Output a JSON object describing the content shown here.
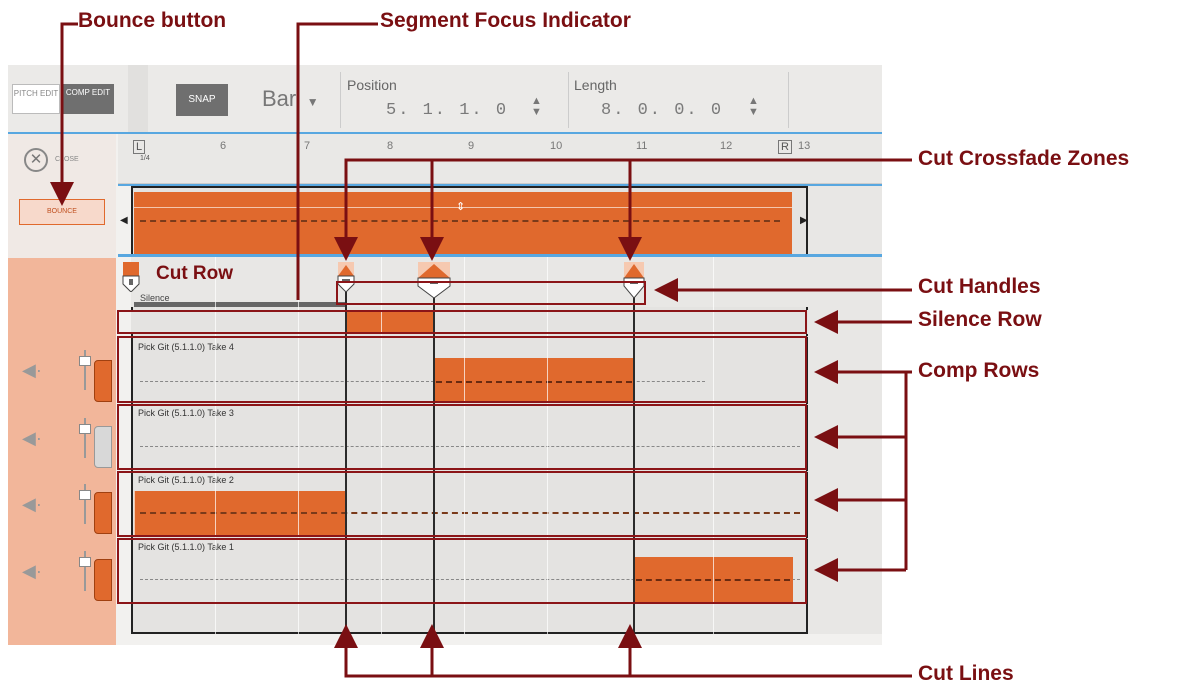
{
  "toolbar": {
    "pitch_edit": "PITCH EDIT",
    "comp_edit": "COMP EDIT",
    "snap": "SNAP",
    "snap_unit": "Bar",
    "position_label": "Position",
    "position_value": "5. 1. 1.   0",
    "length_label": "Length",
    "length_value": "8. 0. 0.   0"
  },
  "close_label": "CLOSE",
  "bounce_label": "BOUNCE",
  "ruler": {
    "start_marker": "L",
    "start_sub": "1/4",
    "bars": [
      "6",
      "7",
      "8",
      "9",
      "10",
      "11",
      "12"
    ],
    "end_marker": "R",
    "end_bar": "13"
  },
  "silence_label": "Silence",
  "takes": [
    {
      "label": "Pick Git (5.1.1.0) Take 4"
    },
    {
      "label": "Pick Git (5.1.1.0) Take 3"
    },
    {
      "label": "Pick Git (5.1.1.0) Take 2"
    },
    {
      "label": "Pick Git (5.1.1.0) Take 1"
    }
  ],
  "annotations": {
    "bounce_button": "Bounce button",
    "segment_focus_indicator": "Segment Focus Indicator",
    "cut_crossfade_zones": "Cut Crossfade Zones",
    "cut_row": "Cut Row",
    "cut_handles": "Cut Handles",
    "silence_row": "Silence Row",
    "comp_rows": "Comp Rows",
    "cut_lines": "Cut Lines"
  },
  "colors": {
    "accent_orange": "#e0692d",
    "callout_red": "#7a0f12",
    "lane_panel": "#f2b69a"
  }
}
